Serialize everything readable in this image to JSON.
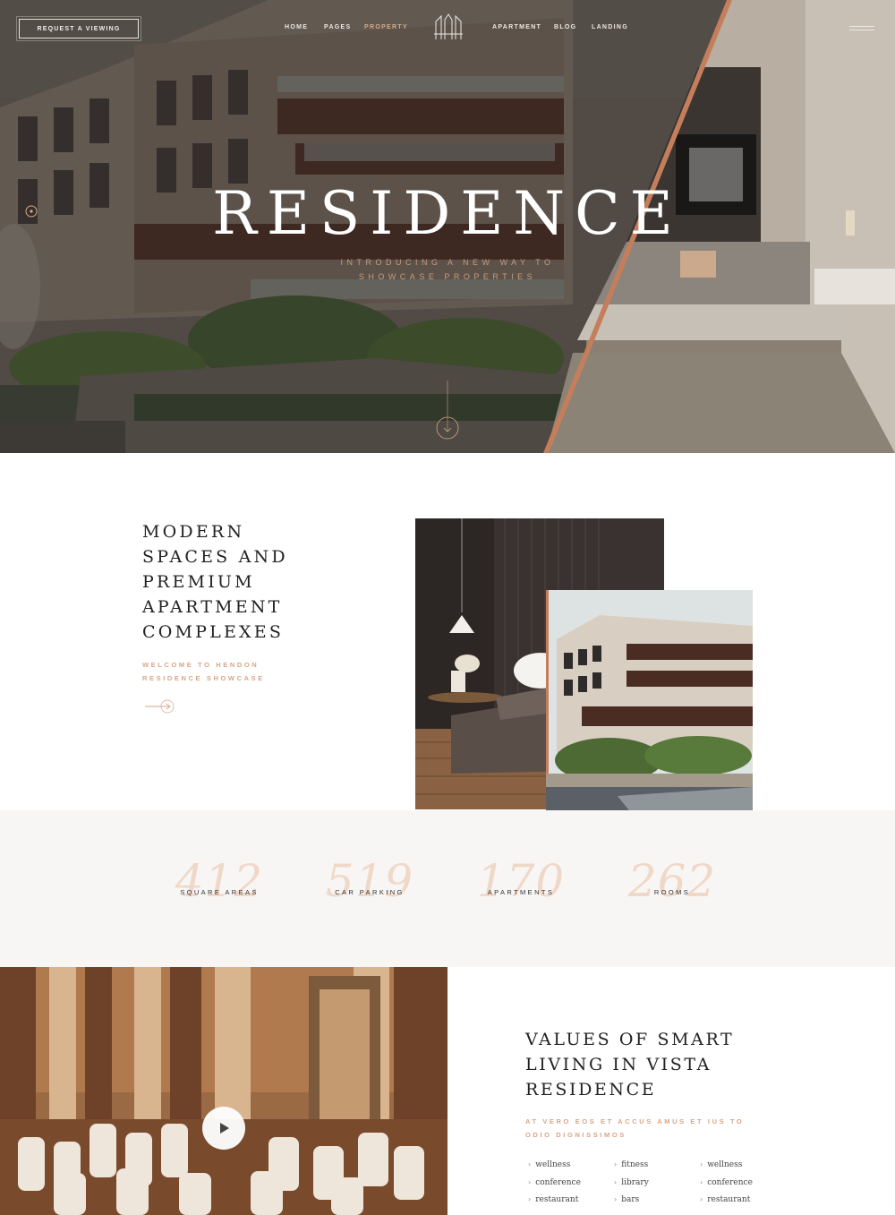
{
  "header": {
    "cta_label": "REQUEST A VIEWING",
    "nav_left": [
      "HOME",
      "PAGES",
      "PROPERTY"
    ],
    "nav_right": [
      "APARTMENT",
      "BLOG",
      "LANDING"
    ],
    "active_nav": "PROPERTY"
  },
  "hero": {
    "title": "RESIDENCE",
    "subtitle_line1": "INTRODUCING A NEW WAY TO",
    "subtitle_line2": "SHOWCASE PROPERTIES"
  },
  "intro": {
    "title_lines": [
      "MODERN",
      "SPACES AND",
      "PREMIUM",
      "APARTMENT",
      "COMPLEXES"
    ],
    "subtitle_line1": "WELCOME TO HENDON",
    "subtitle_line2": "RESIDENCE SHOWCASE"
  },
  "stats": [
    {
      "number": "412",
      "label": "SQUARE AREAS"
    },
    {
      "number": "519",
      "label": "CAR PARKING"
    },
    {
      "number": "170",
      "label": "APARTMENTS"
    },
    {
      "number": "262",
      "label": "ROOMS"
    }
  ],
  "values": {
    "title_lines": [
      "VALUES OF SMART",
      "LIVING IN VISTA",
      "RESIDENCE"
    ],
    "subtitle_line1": "AT VERO EOS ET ACCUS AMUS ET IUS TO",
    "subtitle_line2": "ODIO DIGNISSIMOS",
    "features": [
      [
        "wellness",
        "conference",
        "restaurant"
      ],
      [
        "fitness",
        "library",
        "bars"
      ],
      [
        "wellness",
        "conference",
        "restaurant"
      ]
    ]
  },
  "colors": {
    "accent": "#d9a586",
    "stat_number": "#f0d8c8",
    "stats_bg": "#f8f6f4",
    "hero_overlay": "#5a5550"
  },
  "icons": [
    "logo-icon",
    "menu-icon",
    "scroll-down-icon",
    "arrow-right-icon",
    "play-icon",
    "chevron-right-icon"
  ]
}
